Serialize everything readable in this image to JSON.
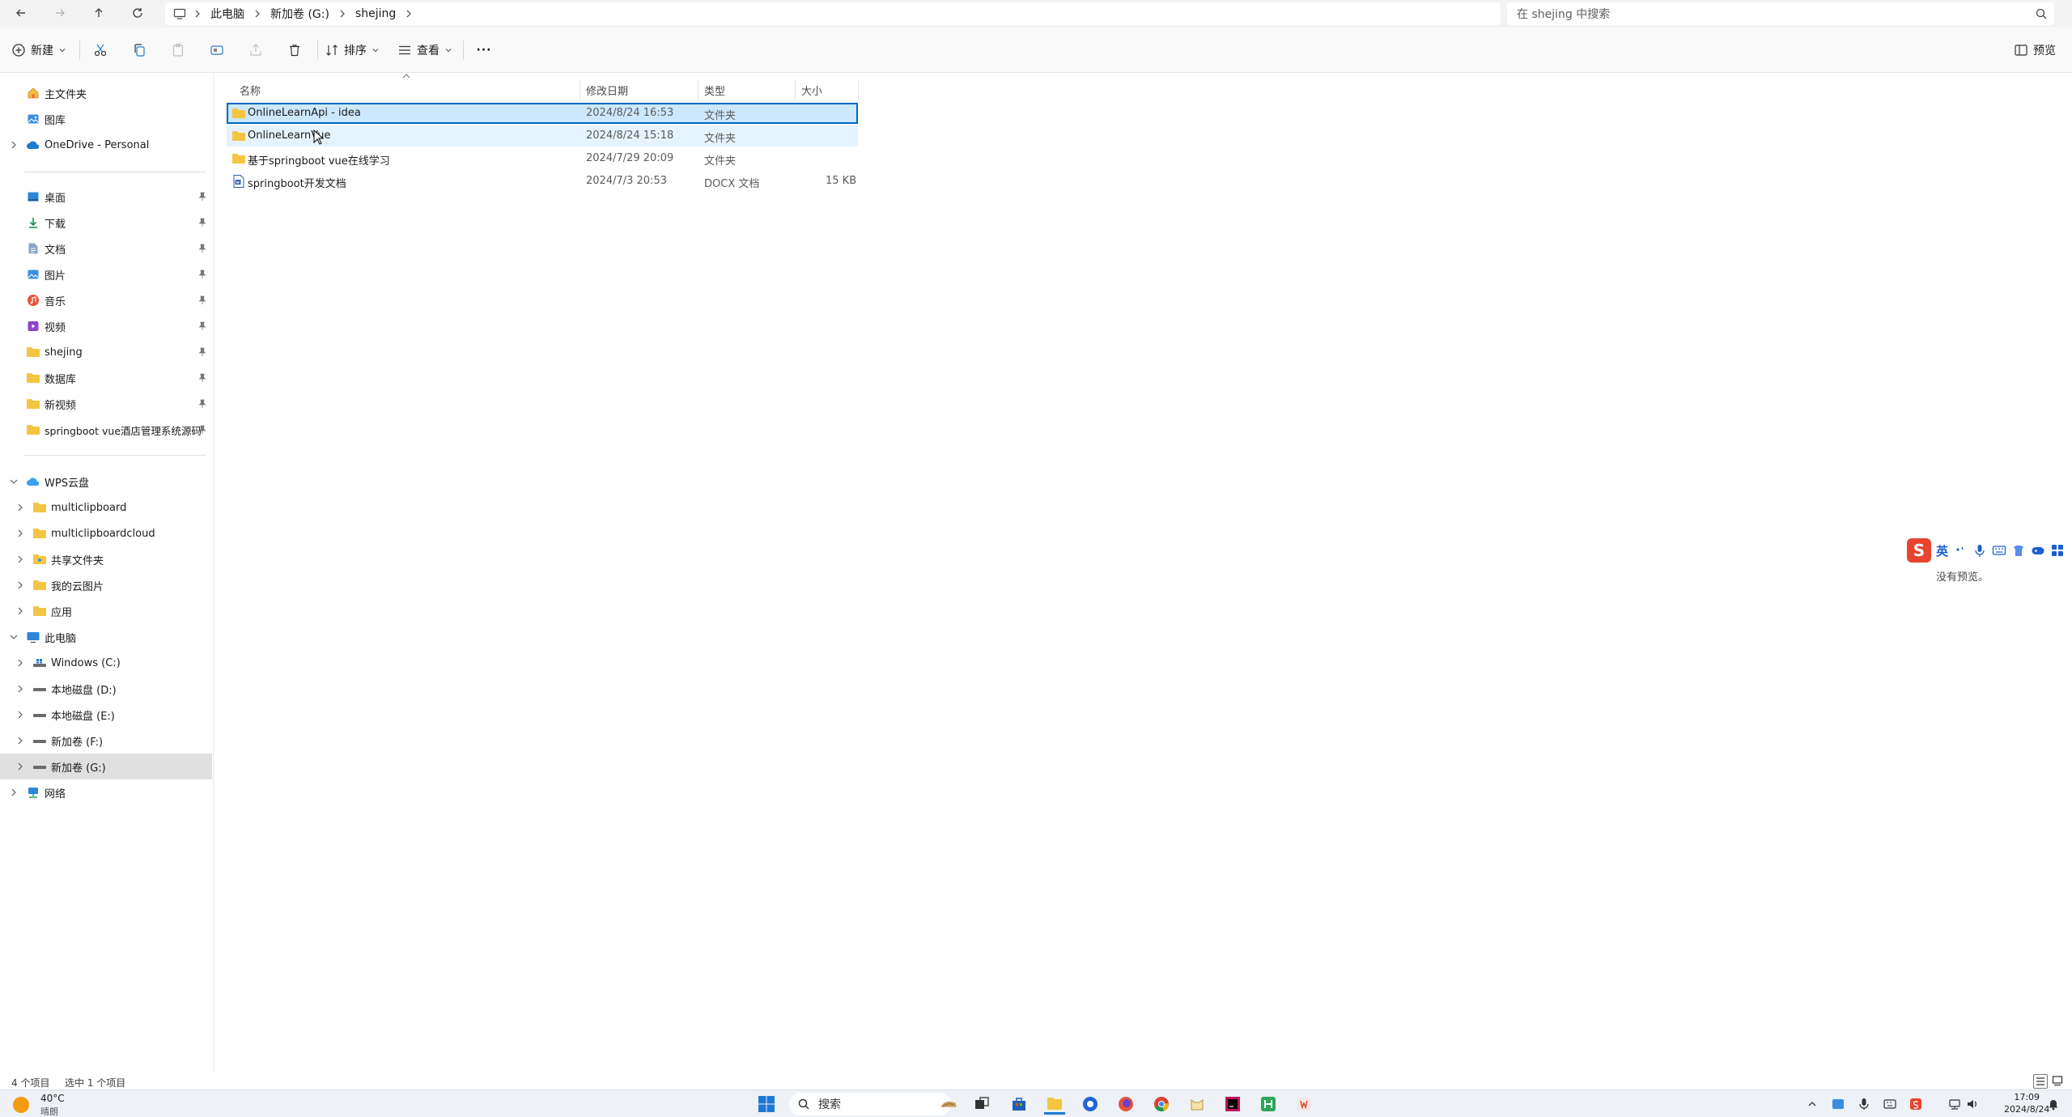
{
  "address_bar": {
    "breadcrumbs": [
      "此电脑",
      "新加卷 (G:)",
      "shejing"
    ],
    "search_placeholder": "在 shejing 中搜索"
  },
  "toolbar": {
    "new_label": "新建",
    "sort_label": "排序",
    "view_label": "查看",
    "more_label": "···",
    "preview_label": "预览"
  },
  "sidebar": {
    "top": [
      {
        "label": "主文件夹",
        "icon": "home-icon"
      },
      {
        "label": "图库",
        "icon": "gallery-icon"
      },
      {
        "label": "OneDrive - Personal",
        "icon": "cloud-icon"
      }
    ],
    "quick_access": [
      {
        "label": "桌面",
        "icon": "desktop-icon"
      },
      {
        "label": "下载",
        "icon": "download-icon"
      },
      {
        "label": "文档",
        "icon": "document-icon"
      },
      {
        "label": "图片",
        "icon": "picture-icon"
      },
      {
        "label": "音乐",
        "icon": "music-icon"
      },
      {
        "label": "视频",
        "icon": "video-icon"
      },
      {
        "label": "shejing",
        "icon": "folder-icon"
      },
      {
        "label": "数据库",
        "icon": "folder-icon"
      },
      {
        "label": "新视频",
        "icon": "folder-icon"
      },
      {
        "label": "springboot vue酒店管理系统源码",
        "icon": "folder-icon"
      }
    ],
    "wps": {
      "label": "WPS云盘",
      "children": [
        "multiclipboard",
        "multiclipboardcloud",
        "共享文件夹",
        "我的云图片",
        "应用"
      ]
    },
    "this_pc": {
      "label": "此电脑",
      "children": [
        "Windows (C:)",
        "本地磁盘 (D:)",
        "本地磁盘 (E:)",
        "新加卷 (F:)",
        "新加卷 (G:)"
      ]
    },
    "network": "网络"
  },
  "file_list": {
    "columns": [
      "名称",
      "修改日期",
      "类型",
      "大小"
    ],
    "rows": [
      {
        "name": "OnlineLearnApi - idea",
        "date": "2024/8/24 16:53",
        "type": "文件夹",
        "size": "",
        "kind": "folder"
      },
      {
        "name": "OnlineLearnVue",
        "date": "2024/8/24 15:18",
        "type": "文件夹",
        "size": "",
        "kind": "folder"
      },
      {
        "name": "基于springboot vue在线学习",
        "date": "2024/7/29 20:09",
        "type": "文件夹",
        "size": "",
        "kind": "folder"
      },
      {
        "name": "springboot开发文档",
        "date": "2024/7/3 20:53",
        "type": "DOCX 文档",
        "size": "15 KB",
        "kind": "docx"
      }
    ]
  },
  "preview": {
    "no_preview": "没有预览。",
    "ime_label": "英"
  },
  "status_bar": {
    "item_count": "4 个项目",
    "selected": "选中 1 个项目"
  },
  "taskbar": {
    "weather_temp": "40°C",
    "weather_cond": "晴朗",
    "search_label": "搜索",
    "time": "17:09",
    "date": "2024/8/24"
  },
  "colors": {
    "accent": "#0067c0",
    "selection_bg": "#cce8ff",
    "hover_bg": "#e5f3ff",
    "folder": "#f4c542"
  }
}
